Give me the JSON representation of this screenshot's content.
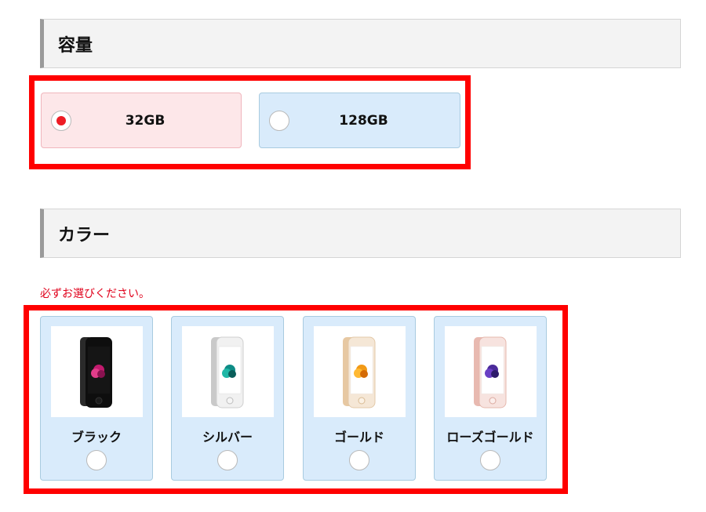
{
  "capacity_section": {
    "title": "容量",
    "options": [
      {
        "label": "32GB",
        "selected": true
      },
      {
        "label": "128GB",
        "selected": false
      }
    ]
  },
  "color_section": {
    "title": "カラー",
    "required_note": "必ずお選びください。",
    "options": [
      {
        "label": "ブラック",
        "icon": "iphone-black-icon"
      },
      {
        "label": "シルバー",
        "icon": "iphone-silver-icon"
      },
      {
        "label": "ゴールド",
        "icon": "iphone-gold-icon"
      },
      {
        "label": "ローズゴールド",
        "icon": "iphone-rose-gold-icon"
      }
    ]
  },
  "colors": {
    "highlight_border": "#ff0000",
    "selected_bg": "#fde7e9",
    "option_bg": "#d9ebfb",
    "required_text": "#e0001b",
    "radio_dot": "#ee1c25"
  }
}
